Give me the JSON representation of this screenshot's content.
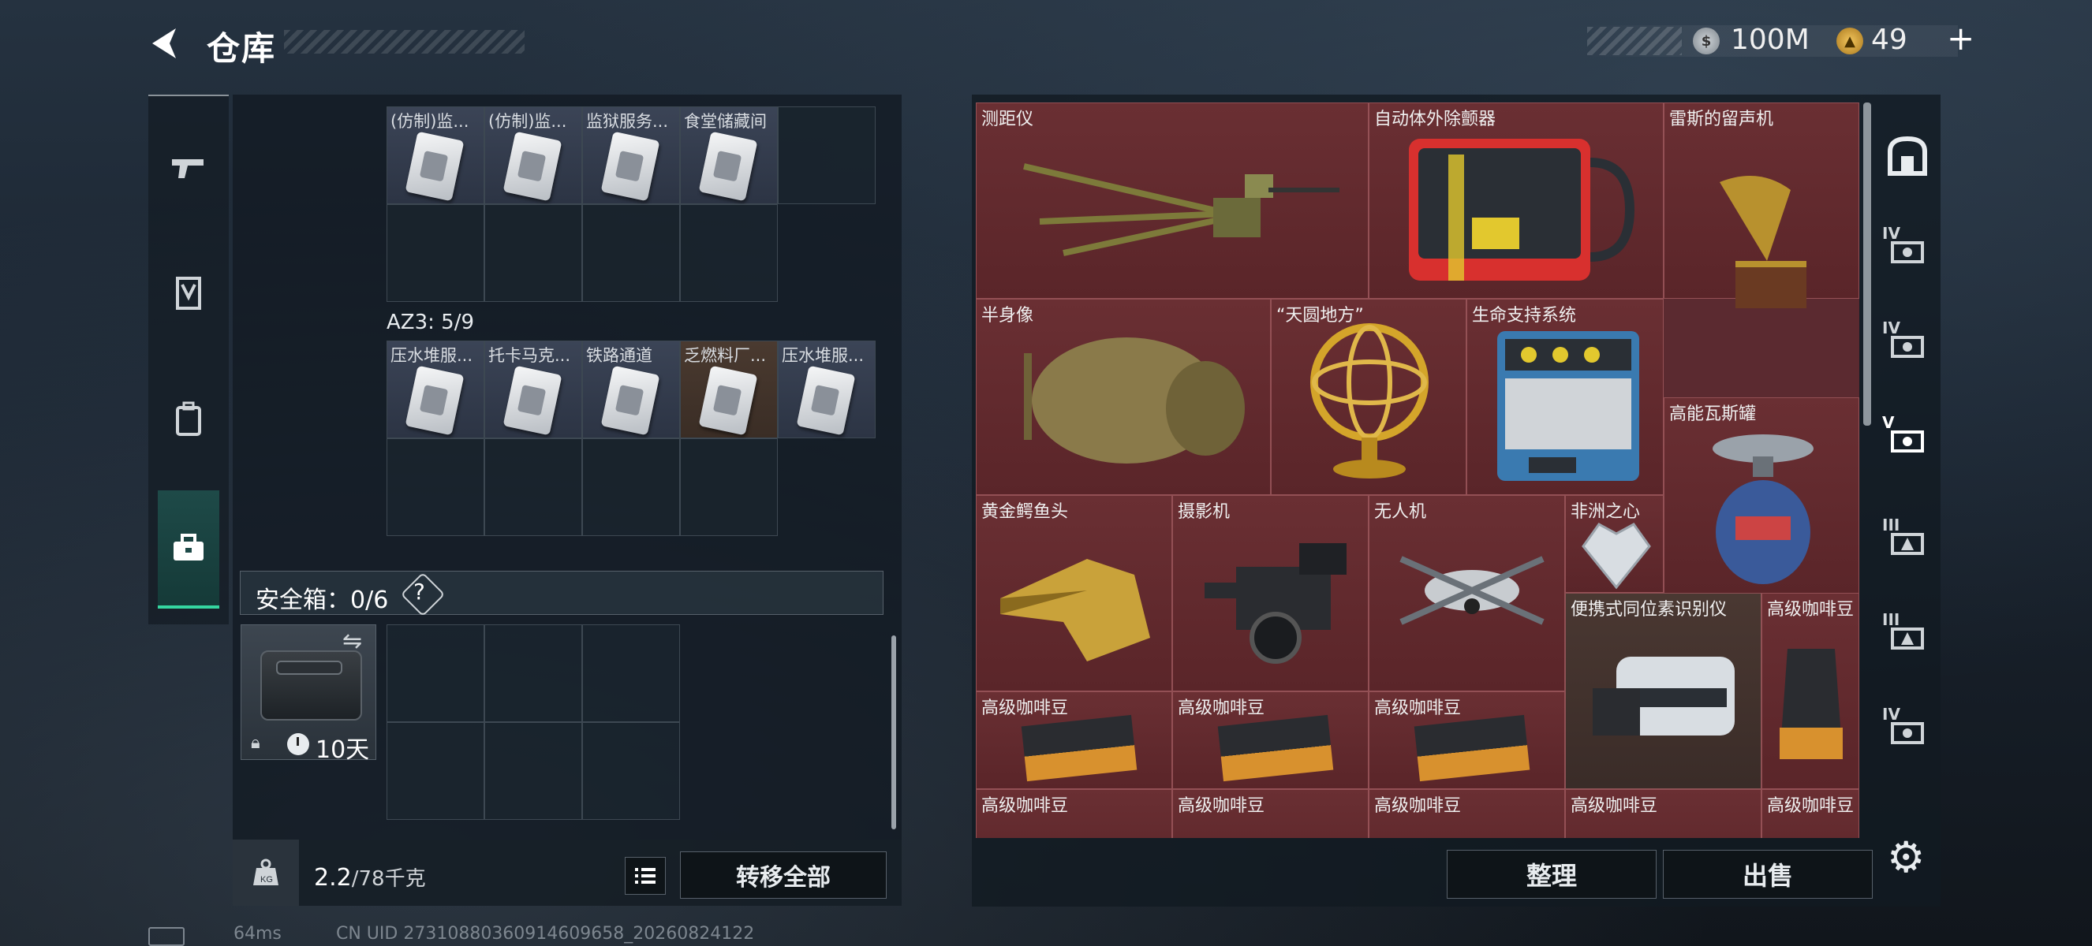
{
  "header": {
    "title": "仓库",
    "currency_silver": "100M",
    "currency_gold": "49",
    "plus": "+"
  },
  "tabs": [
    "weapon-icon",
    "armor-icon",
    "backpack-icon",
    "toolbox-icon"
  ],
  "left": {
    "row1_labels": [
      "(仿制)监...",
      "(仿制)监...",
      "监狱服务...",
      "食堂储藏间"
    ],
    "az3_label": "AZ3: 5/9",
    "row2_labels": [
      "压水堆服...",
      "托卡马克...",
      "铁路通道",
      "乏燃料厂...",
      "压水堆服..."
    ],
    "safe_label": "安全箱：0/6",
    "safe_help": "?",
    "safe_days": "10天",
    "weight": "2.2",
    "weight_max": "/78千克",
    "transfer_all": "转移全部"
  },
  "stash": {
    "items": [
      {
        "label": "测距仪"
      },
      {
        "label": "自动体外除颤器"
      },
      {
        "label": "雷斯的留声机"
      },
      {
        "label": "半身像"
      },
      {
        "label": "“天圆地方”"
      },
      {
        "label": "生命支持系统"
      },
      {
        "label": "高能瓦斯罐"
      },
      {
        "label": "黄金鳄鱼头"
      },
      {
        "label": "摄影机"
      },
      {
        "label": "无人机"
      },
      {
        "label": "非洲之心"
      },
      {
        "label": "便携式同位素识别仪"
      },
      {
        "label": "高级咖啡豆"
      },
      {
        "label": "高级咖啡豆"
      },
      {
        "label": "高级咖啡豆"
      },
      {
        "label": "高级咖啡豆"
      },
      {
        "label": "高级咖啡豆"
      },
      {
        "label": "高级咖啡豆"
      },
      {
        "label": "高级咖啡豆"
      },
      {
        "label": "高级咖啡豆"
      },
      {
        "label": "高级咖啡豆"
      }
    ],
    "arrange": "整理",
    "sell": "出售",
    "tiers": [
      "IV",
      "IV",
      "V",
      "III",
      "III",
      "IV"
    ]
  },
  "footer": {
    "ping": "64ms",
    "uid": "CN UID 27310880360914609658_20260824122"
  }
}
